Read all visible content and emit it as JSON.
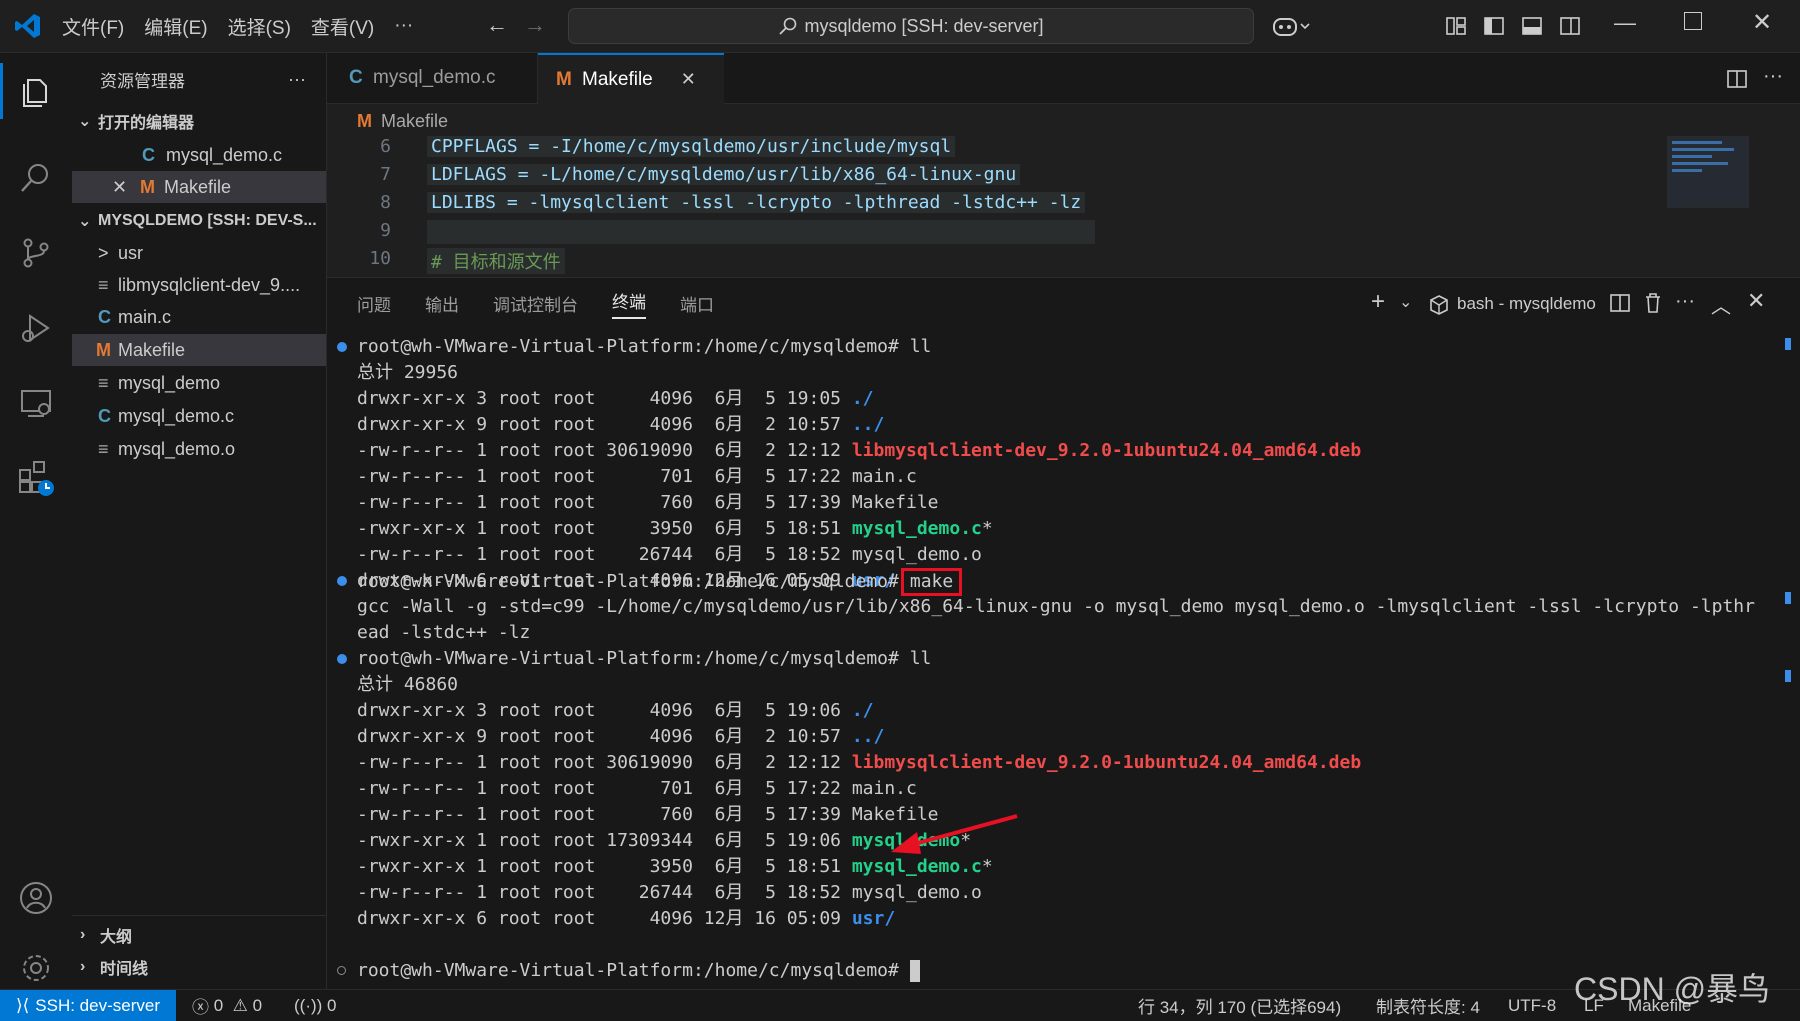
{
  "titlebar": {
    "menus": [
      "文件(F)",
      "编辑(E)",
      "选择(S)",
      "查看(V)",
      "···"
    ],
    "search_text": "mysqldemo [SSH: dev-server]"
  },
  "sidebar": {
    "title": "资源管理器",
    "more": "···",
    "open_editors_header": "打开的编辑器",
    "open_editors": [
      {
        "icon": "C",
        "label": "mysql_demo.c"
      },
      {
        "icon": "M",
        "label": "Makefile"
      }
    ],
    "workspace_header": "MYSQLDEMO [SSH: DEV-S...",
    "files": [
      {
        "icon": ">",
        "label": "usr"
      },
      {
        "icon": "≡",
        "label": "libmysqlclient-dev_9...."
      },
      {
        "icon": "C",
        "label": "main.c"
      },
      {
        "icon": "M",
        "label": "Makefile"
      },
      {
        "icon": "≡",
        "label": "mysql_demo"
      },
      {
        "icon": "C",
        "label": "mysql_demo.c"
      },
      {
        "icon": "≡",
        "label": "mysql_demo.o"
      }
    ],
    "outline": "大纲",
    "timeline": "时间线"
  },
  "tabs": [
    {
      "icon": "C",
      "label": "mysql_demo.c"
    },
    {
      "icon": "M",
      "label": "Makefile",
      "close": "✕"
    }
  ],
  "breadcrumb": {
    "icon": "M",
    "label": "Makefile"
  },
  "code": [
    {
      "n": "6",
      "text": "CPPFLAGS = -I/home/c/mysqldemo/usr/include/mysql"
    },
    {
      "n": "7",
      "text": "LDFLAGS = -L/home/c/mysqldemo/usr/lib/x86_64-linux-gnu"
    },
    {
      "n": "8",
      "text": "LDLIBS = -lmysqlclient -lssl -lcrypto -lpthread -lstdc++ -lz"
    },
    {
      "n": "9",
      "text": ""
    },
    {
      "n": "10",
      "text": "# 目标和源文件"
    }
  ],
  "panel": {
    "tabs": [
      "问题",
      "输出",
      "调试控制台",
      "终端",
      "端口"
    ],
    "active_tab": "终端",
    "terminal_name": "bash - mysqldemo"
  },
  "terminal": {
    "prompt": "root@wh-VMware-Virtual-Platform:/home/c/mysqldemo#",
    "cmd1": "ll",
    "total1": "总计 29956",
    "list1": [
      {
        "meta": "drwxr-xr-x 3 root root     4096  6月  5 19:05 ",
        "name": "./",
        "cls": "blue",
        "suffix": ""
      },
      {
        "meta": "drwxr-xr-x 9 root root     4096  6月  2 10:57 ",
        "name": "../",
        "cls": "blue",
        "suffix": ""
      },
      {
        "meta": "-rw-r--r-- 1 root root 30619090  6月  2 12:12 ",
        "name": "libmysqlclient-dev_9.2.0-1ubuntu24.04_amd64.deb",
        "cls": "red",
        "suffix": ""
      },
      {
        "meta": "-rw-r--r-- 1 root root      701  6月  5 17:22 ",
        "name": "main.c",
        "cls": "",
        "suffix": ""
      },
      {
        "meta": "-rw-r--r-- 1 root root      760  6月  5 17:39 ",
        "name": "Makefile",
        "cls": "",
        "suffix": ""
      },
      {
        "meta": "-rwxr-xr-x 1 root root     3950  6月  5 18:51 ",
        "name": "mysql_demo.c",
        "cls": "green",
        "suffix": "*"
      },
      {
        "meta": "-rw-r--r-- 1 root root    26744  6月  5 18:52 ",
        "name": "mysql_demo.o",
        "cls": "",
        "suffix": ""
      },
      {
        "meta": "drwxr-xr-x 6 root root     4096 12月 16 05:09 ",
        "name": "usr/",
        "cls": "blue",
        "suffix": ""
      }
    ],
    "cmd2": "make",
    "gcc_line1": "gcc -Wall -g -std=c99 -L/home/c/mysqldemo/usr/lib/x86_64-linux-gnu -o mysql_demo mysql_demo.o -lmysqlclient -lssl -lcrypto -lpthr",
    "gcc_line2": "ead -lstdc++ -lz",
    "cmd3": "ll",
    "total2": "总计 46860",
    "list2": [
      {
        "meta": "drwxr-xr-x 3 root root     4096  6月  5 19:06 ",
        "name": "./",
        "cls": "blue",
        "suffix": ""
      },
      {
        "meta": "drwxr-xr-x 9 root root     4096  6月  2 10:57 ",
        "name": "../",
        "cls": "blue",
        "suffix": ""
      },
      {
        "meta": "-rw-r--r-- 1 root root 30619090  6月  2 12:12 ",
        "name": "libmysqlclient-dev_9.2.0-1ubuntu24.04_amd64.deb",
        "cls": "red",
        "suffix": ""
      },
      {
        "meta": "-rw-r--r-- 1 root root      701  6月  5 17:22 ",
        "name": "main.c",
        "cls": "",
        "suffix": ""
      },
      {
        "meta": "-rw-r--r-- 1 root root      760  6月  5 17:39 ",
        "name": "Makefile",
        "cls": "",
        "suffix": ""
      },
      {
        "meta": "-rwxr-xr-x 1 root root 17309344  6月  5 19:06 ",
        "name": "mysql_demo",
        "cls": "green",
        "suffix": "*"
      },
      {
        "meta": "-rwxr-xr-x 1 root root     3950  6月  5 18:51 ",
        "name": "mysql_demo.c",
        "cls": "green",
        "suffix": "*"
      },
      {
        "meta": "-rw-r--r-- 1 root root    26744  6月  5 18:52 ",
        "name": "mysql_demo.o",
        "cls": "",
        "suffix": ""
      },
      {
        "meta": "drwxr-xr-x 6 root root     4096 12月 16 05:09 ",
        "name": "usr/",
        "cls": "blue",
        "suffix": ""
      }
    ]
  },
  "statusbar": {
    "remote": "SSH: dev-server",
    "errors": "0",
    "warnings": "0",
    "ports": "0",
    "position": "行 34，列 170 (已选择694)",
    "tab_size": "制表符长度: 4",
    "encoding": "UTF-8",
    "eol": "LF",
    "language": "Makefile"
  },
  "watermark": "CSDN @暴鸟",
  "colors": {
    "accent": "#0078d4",
    "red_box": "#e81123",
    "c_icon": "#519aba",
    "m_icon": "#e37933"
  }
}
